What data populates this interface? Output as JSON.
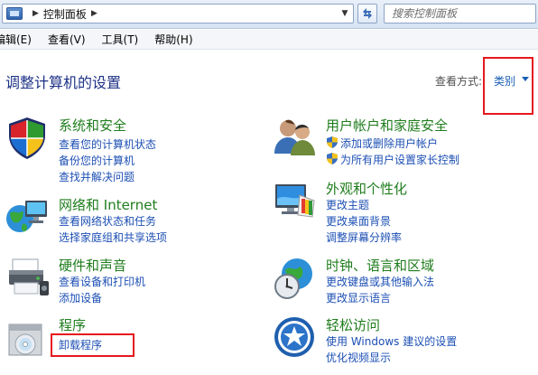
{
  "address_bar": {
    "breadcrumb": "控制面板",
    "search_placeholder": "搜索控制面板"
  },
  "menu": {
    "items": [
      "编辑(E)",
      "查看(V)",
      "工具(T)",
      "帮助(H)"
    ]
  },
  "header": {
    "title": "调整计算机的设置",
    "view_by_label": "查看方式:",
    "view_by_value": "类别"
  },
  "categories": {
    "system": {
      "title": "系统和安全",
      "icon": "shield-security-icon",
      "links": [
        "查看您的计算机状态",
        "备份您的计算机",
        "查找并解决问题"
      ]
    },
    "network": {
      "title": "网络和 Internet",
      "icon": "network-globe-icon",
      "links": [
        "查看网络状态和任务",
        "选择家庭组和共享选项"
      ]
    },
    "hardware": {
      "title": "硬件和声音",
      "icon": "printer-hardware-icon",
      "links": [
        "查看设备和打印机",
        "添加设备"
      ]
    },
    "programs": {
      "title": "程序",
      "icon": "programs-disc-icon",
      "links": [
        "卸载程序"
      ]
    },
    "users": {
      "title": "用户帐户和家庭安全",
      "icon": "users-icon",
      "links": [
        "添加或删除用户帐户",
        "为所有用户设置家长控制"
      ]
    },
    "appearance": {
      "title": "外观和个性化",
      "icon": "monitor-palette-icon",
      "links": [
        "更改主题",
        "更改桌面背景",
        "调整屏幕分辨率"
      ]
    },
    "clock": {
      "title": "时钟、语言和区域",
      "icon": "clock-globe-icon",
      "links": [
        "更改键盘或其他输入法",
        "更改显示语言"
      ]
    },
    "ease": {
      "title": "轻松访问",
      "icon": "ease-of-access-icon",
      "links": [
        "使用 Windows 建议的设置",
        "优化视频显示"
      ]
    }
  },
  "colors": {
    "category_title": "#1f7d1d",
    "link": "#1c4fb4",
    "page_title": "#1e3287",
    "highlight": "#e5181d"
  }
}
